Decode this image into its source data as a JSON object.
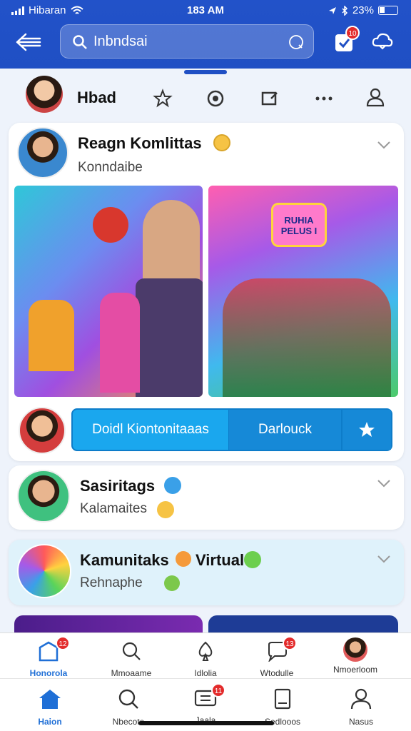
{
  "status": {
    "carrier": "Hibaran",
    "time": "183 AM",
    "battery": "23%"
  },
  "header": {
    "search_value": "Inbndsai",
    "notif_badge": "10"
  },
  "storybar": {
    "name": "Hbad"
  },
  "post1": {
    "title": "Reagn Komlittas",
    "subtitle": "Konndaibe",
    "image_right_banner": "RUHIA PELUS I",
    "action_primary": "Doidl Kiontonitaaas",
    "action_secondary": "Darlouck"
  },
  "post2": {
    "title": "Sasiritags",
    "subtitle": "Kalamaites"
  },
  "post3": {
    "title": "Kamunitaks",
    "title_suffix": "Virtual",
    "subtitle": "Rehnaphe"
  },
  "tabs_top": [
    {
      "label": "Honorola",
      "icon": "group-icon",
      "badge": "12"
    },
    {
      "label": "Mmoaame",
      "icon": "search-icon"
    },
    {
      "label": "Idlolia",
      "icon": "spade-icon"
    },
    {
      "label": "Wtodulle",
      "icon": "chat-icon",
      "badge": "13"
    },
    {
      "label": "Nmoerloom",
      "icon": "profile-avatar"
    }
  ],
  "tabs_bottom": [
    {
      "label": "Haion",
      "icon": "home-icon"
    },
    {
      "label": "Nbecote",
      "icon": "search-icon"
    },
    {
      "label": "Jaala",
      "icon": "ticket-icon",
      "badge": "11"
    },
    {
      "label": "Sedlooos",
      "icon": "document-icon"
    },
    {
      "label": "Nasus",
      "icon": "person-icon"
    }
  ],
  "colors": {
    "brand": "#1f4fc4",
    "accent": "#1aa7ee",
    "badge": "#e32b2b"
  }
}
